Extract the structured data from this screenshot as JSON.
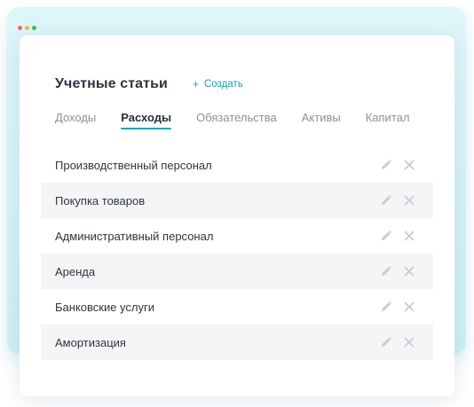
{
  "window": {
    "dots": [
      {
        "name": "close-dot",
        "color": "#f06560"
      },
      {
        "name": "minimize-dot",
        "color": "#f5b73d"
      },
      {
        "name": "maximize-dot",
        "color": "#34c455"
      }
    ]
  },
  "header": {
    "title": "Учетные статьи",
    "create_icon": "plus-icon",
    "create_label": "Создать"
  },
  "tabs": [
    {
      "label": "Доходы",
      "active": false
    },
    {
      "label": "Расходы",
      "active": true
    },
    {
      "label": "Обязательства",
      "active": false
    },
    {
      "label": "Активы",
      "active": false
    },
    {
      "label": "Капитал",
      "active": false
    }
  ],
  "items": [
    {
      "label": "Производственный персонал"
    },
    {
      "label": "Покупка товаров"
    },
    {
      "label": "Административный персонал"
    },
    {
      "label": "Аренда"
    },
    {
      "label": "Банковские услуги"
    },
    {
      "label": "Амортизация"
    }
  ],
  "row_actions": {
    "edit_icon": "pencil-icon",
    "delete_icon": "close-icon"
  },
  "colors": {
    "accent": "#1aa7b0",
    "icon_muted": "#c9ccd1",
    "row_alt": "#f4f5f7"
  }
}
